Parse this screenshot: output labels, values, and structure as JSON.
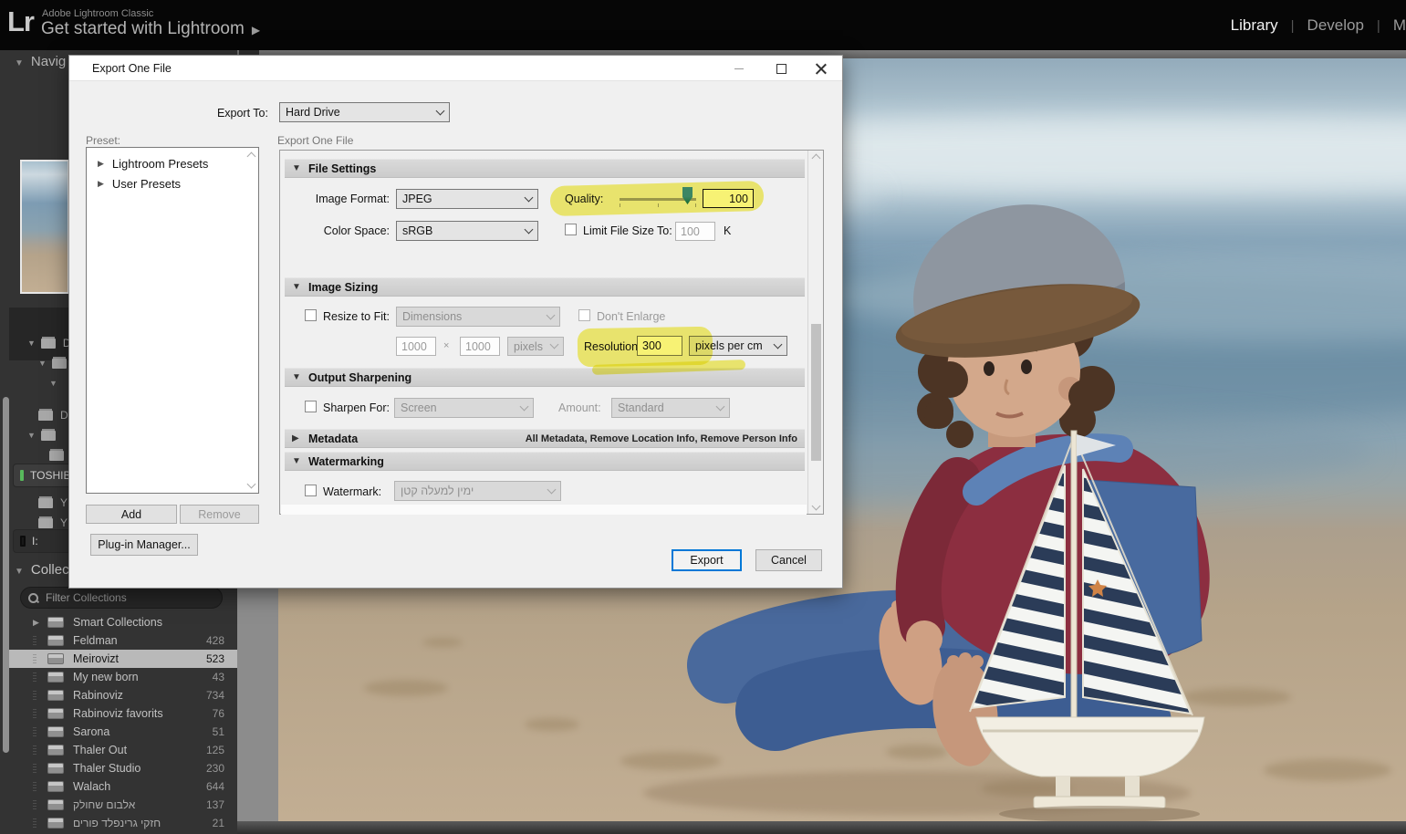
{
  "icons": {
    "tri_down": "▼",
    "tri_right": "▶",
    "times": "×"
  },
  "app": {
    "logo": "Lr",
    "brand_line1": "Adobe Lightroom Classic",
    "brand_line2": "Get started with Lightroom",
    "nav": [
      {
        "label": "Library"
      },
      {
        "label": "Develop"
      },
      {
        "label": "M"
      }
    ]
  },
  "left_panel": {
    "navigator_title": "Navig",
    "folders": {
      "f1": "D",
      "f2": "D",
      "drive1": "TOSHIB",
      "y1": "Y",
      "y2": "Y",
      "drive2": "I:"
    },
    "collections_title": "Collec",
    "filter_label": "Filter Collections",
    "items": [
      {
        "label": "Smart Collections",
        "count": ""
      },
      {
        "label": "Feldman",
        "count": "428"
      },
      {
        "label": "Meirovizt",
        "count": "523"
      },
      {
        "label": "My new born",
        "count": "43"
      },
      {
        "label": "Rabinoviz",
        "count": "734"
      },
      {
        "label": "Rabinoviz favorits",
        "count": "76"
      },
      {
        "label": "Sarona",
        "count": "51"
      },
      {
        "label": "Thaler Out",
        "count": "125"
      },
      {
        "label": "Thaler Studio",
        "count": "230"
      },
      {
        "label": "Walach",
        "count": "644"
      },
      {
        "label": "אלבום שחולק",
        "count": "137"
      },
      {
        "label": "חזקי גרינפלד פורים",
        "count": "21"
      }
    ]
  },
  "dialog": {
    "title": "Export One File",
    "export_to_label": "Export To:",
    "export_to_value": "Hard Drive",
    "preset_label": "Preset:",
    "panel_caption": "Export One File",
    "presets": [
      {
        "label": "Lightroom Presets"
      },
      {
        "label": "User Presets"
      }
    ],
    "add_label": "Add",
    "remove_label": "Remove",
    "file_settings": {
      "header": "File Settings",
      "image_format_label": "Image Format:",
      "image_format_value": "JPEG",
      "quality_label": "Quality:",
      "quality_value": "100",
      "color_space_label": "Color Space:",
      "color_space_value": "sRGB",
      "limit_label": "Limit File Size To:",
      "limit_value": "100",
      "limit_unit": "K"
    },
    "image_sizing": {
      "header": "Image Sizing",
      "resize_label": "Resize to Fit:",
      "resize_value": "Dimensions",
      "dont_enlarge_label": "Don't Enlarge",
      "width_value": "1000",
      "height_value": "1000",
      "unit_value": "pixels",
      "resolution_label": "Resolution:",
      "resolution_value": "300",
      "resolution_unit": "pixels per cm"
    },
    "output_sharpening": {
      "header": "Output Sharpening",
      "sharpen_label": "Sharpen For:",
      "sharpen_value": "Screen",
      "amount_label": "Amount:",
      "amount_value": "Standard"
    },
    "metadata": {
      "header": "Metadata",
      "summary": "All Metadata, Remove Location Info, Remove Person Info"
    },
    "watermarking": {
      "header": "Watermarking",
      "watermark_label": "Watermark:",
      "watermark_value": "ימין למעלה קטן"
    },
    "plugin_manager_label": "Plug-in Manager...",
    "export_label": "Export",
    "cancel_label": "Cancel"
  },
  "colors": {
    "highlight": "#f2ea1e",
    "accent": "#0078d7"
  }
}
